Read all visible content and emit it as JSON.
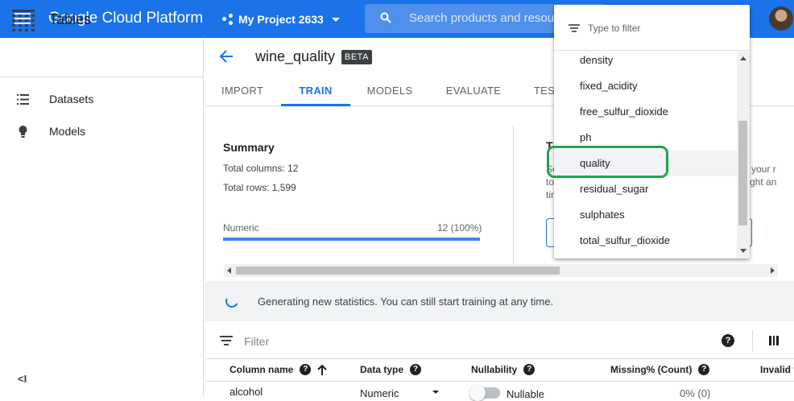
{
  "app": {
    "brand": "Google Cloud Platform",
    "project": "My Project 2633"
  },
  "search": {
    "placeholder": "Search products and resources"
  },
  "sidebar": {
    "title": "Tables",
    "items": [
      {
        "label": "Datasets",
        "icon": "list-icon"
      },
      {
        "label": "Models",
        "icon": "lightbulb-icon"
      }
    ],
    "collapse": "<I"
  },
  "dataset": {
    "name": "wine_quality",
    "badge": "BETA"
  },
  "tabs": [
    "IMPORT",
    "TRAIN",
    "MODELS",
    "EVALUATE",
    "TES"
  ],
  "active_tab": "TRAIN",
  "summary": {
    "title": "Summary",
    "total_columns": "Total columns: 12",
    "total_rows": "Total rows: 1,599",
    "numeric_label": "Numeric",
    "numeric_value": "12 (100%)",
    "numeric_fraction": 1.0
  },
  "right_panel": {
    "title_fragment": "T",
    "lines": [
      "Se",
      "to",
      "tin"
    ],
    "right_lines": [
      "your r",
      "ght an"
    ]
  },
  "banner": {
    "text": "Generating new statistics. You can still start training at any time."
  },
  "filter": {
    "placeholder": "Filter"
  },
  "table": {
    "headers": [
      "Column name",
      "Data type",
      "Nullability",
      "Missing% (Count)",
      "Invalid v"
    ],
    "rows": [
      {
        "name": "alcohol",
        "type": "Numeric",
        "nullability": "Nullable",
        "missing": "0% (0)"
      }
    ]
  },
  "dropdown": {
    "placeholder": "Type to filter",
    "items": [
      "density",
      "fixed_acidity",
      "free_sulfur_dioxide",
      "ph",
      "quality",
      "residual_sugar",
      "sulphates",
      "total_sulfur_dioxide"
    ],
    "highlighted": "quality"
  },
  "colors": {
    "primary": "#1a73e8",
    "highlight_ring": "#21a34a"
  }
}
